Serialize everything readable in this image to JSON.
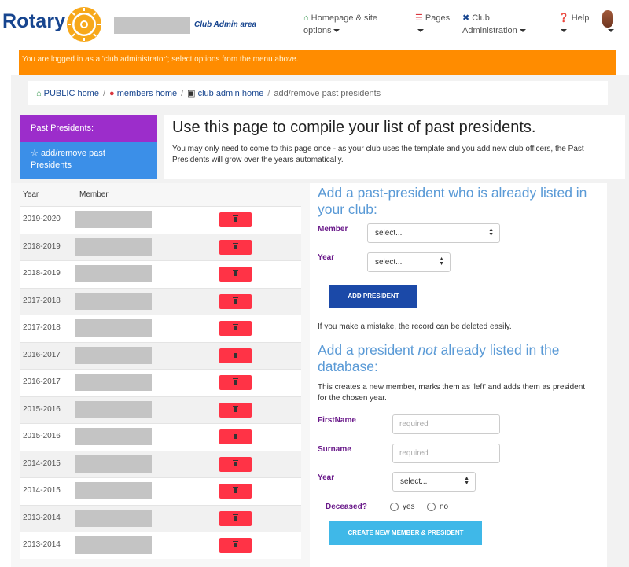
{
  "header": {
    "logo_text": "Rotary",
    "club_admin_area": "Club Admin area",
    "nav": {
      "home": "Homepage & site options",
      "pages": "Pages",
      "club": "Club Administration",
      "help": "Help"
    }
  },
  "banner": "You are logged in as a 'club administrator'; select options from the menu above.",
  "breadcrumb": {
    "public_home": "PUBLIC home",
    "members_home": "members home",
    "club_admin_home": "club admin home",
    "current": "add/remove past presidents"
  },
  "side": {
    "title": "Past Presidents:",
    "item": "add/remove past Presidents"
  },
  "intro": {
    "heading": "Use this page to compile your list of past presidents.",
    "body": "You may only need to come to this page once - as your club uses the template and you add new club officers, the Past Presidents will grow over the years automatically."
  },
  "table": {
    "col_year": "Year",
    "col_member": "Member",
    "rows": [
      "2019-2020",
      "2018-2019",
      "2018-2019",
      "2017-2018",
      "2017-2018",
      "2016-2017",
      "2016-2017",
      "2015-2016",
      "2015-2016",
      "2014-2015",
      "2014-2015",
      "2013-2014",
      "2013-2014"
    ]
  },
  "form1": {
    "heading": "Add a past-president who is already listed in your club:",
    "member_label": "Member",
    "member_value": "select...",
    "year_label": "Year",
    "year_value": "select...",
    "button": "ADD PRESIDENT",
    "note": "If you make a mistake, the record can be deleted easily."
  },
  "form2": {
    "heading_a": "Add a president ",
    "heading_em": "not",
    "heading_b": " already listed in the database:",
    "description": "This creates a new member, marks them as 'left' and adds them as president for the chosen year.",
    "firstname_label": "FirstName",
    "firstname_placeholder": "required",
    "surname_label": "Surname",
    "surname_placeholder": "required",
    "year_label": "Year",
    "year_value": "select...",
    "deceased_label": "Deceased?",
    "yes": "yes",
    "no": "no",
    "button": "CREATE NEW MEMBER & PRESIDENT"
  }
}
